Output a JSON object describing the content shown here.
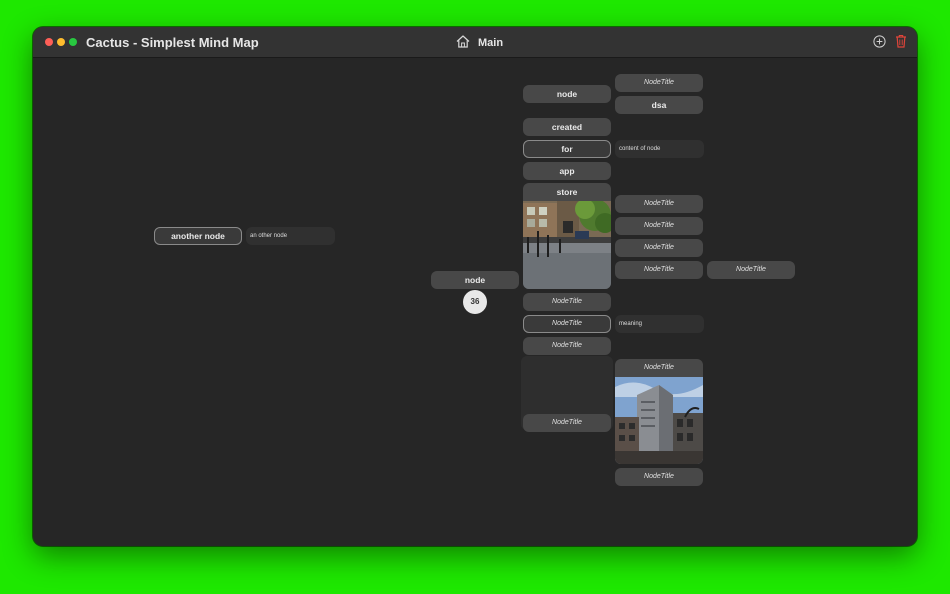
{
  "window": {
    "title": "Cactus - Simplest Mind Map",
    "breadcrumb": "Main"
  },
  "nodes": {
    "another_node": "another node",
    "another_node_content": "an other node",
    "center_node": "node",
    "child_count": "36",
    "c_node": "node",
    "c_created": "created",
    "c_for": "for",
    "c_app": "app",
    "c_store": "store",
    "c_nt1": "NodeTitle",
    "c_nt2": "NodeTitle",
    "c_nt3": "NodeTitle",
    "c_nt4": "NodeTitle",
    "g_nt_top": "NodeTitle",
    "g_dsa": "dsa",
    "g_content_of_node": "content of node",
    "g_nt_a": "NodeTitle",
    "g_nt_b": "NodeTitle",
    "g_nt_c": "NodeTitle",
    "g_nt_d": "NodeTitle",
    "g_meaning": "meaning",
    "g_nt_photo": "NodeTitle",
    "g_nt_bottom": "NodeTitle",
    "gg_nt": "NodeTitle"
  },
  "colors": {
    "desktop": "#1ee800",
    "canvas": "#262626",
    "node": "#484848",
    "trash": "#e0453a"
  }
}
